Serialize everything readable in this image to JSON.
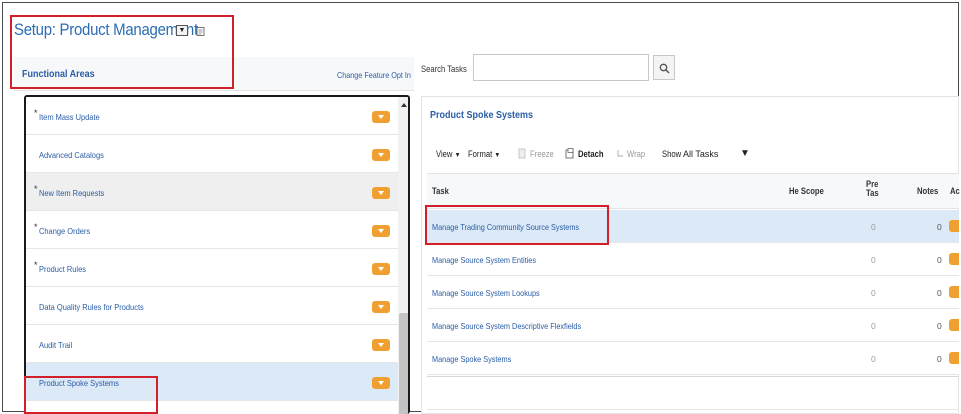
{
  "header": {
    "title": "Setup: Product Management",
    "title_dropdown_icon": "square-dropdown-icon",
    "task_icon": "task-list-icon"
  },
  "functional_areas": {
    "title": "Functional Areas",
    "change_link": "Change Feature Opt In",
    "items": [
      {
        "label": "Item Mass Update",
        "required": true,
        "selected": false
      },
      {
        "label": "Advanced Catalogs",
        "required": false,
        "selected": false
      },
      {
        "label": "New Item Requests",
        "required": true,
        "selected": false
      },
      {
        "label": "Change Orders",
        "required": true,
        "selected": false
      },
      {
        "label": "Product Rules",
        "required": true,
        "selected": false
      },
      {
        "label": "Data Quality Rules for Products",
        "required": false,
        "selected": false
      },
      {
        "label": "Audit Trail",
        "required": false,
        "selected": false
      },
      {
        "label": "Product Spoke Systems",
        "required": false,
        "selected": true
      }
    ]
  },
  "search": {
    "label": "Search Tasks",
    "value": "",
    "placeholder": "",
    "button_icon": "magnifier-icon"
  },
  "tasks_panel": {
    "title": "Product Spoke Systems",
    "toolbar": {
      "view": "View",
      "format": "Format",
      "freeze": "Freeze",
      "detach": "Detach",
      "wrap": "Wrap",
      "show_label": "Show",
      "show_value": "All Tasks",
      "show_options": [
        "All Tasks"
      ]
    },
    "columns": {
      "task": "Task",
      "scope": "He Scope",
      "pre_line1": "Pre",
      "pre_line2": "Tas",
      "notes": "Notes",
      "actions": "Ac"
    },
    "rows": [
      {
        "task": "Manage Trading Community Source Systems",
        "pre": "0",
        "notes": "0",
        "selected": true
      },
      {
        "task": "Manage Source System Entities",
        "pre": "0",
        "notes": "0",
        "selected": false
      },
      {
        "task": "Manage Source System Lookups",
        "pre": "0",
        "notes": "0",
        "selected": false
      },
      {
        "task": "Manage Source System Descriptive Flexfields",
        "pre": "0",
        "notes": "0",
        "selected": false
      },
      {
        "task": "Manage Spoke Systems",
        "pre": "0",
        "notes": "0",
        "selected": false
      }
    ]
  },
  "colors": {
    "link": "#2a5da5",
    "title": "#2a6db5",
    "badge": "#f0a030",
    "highlight": "#d2202a",
    "selection": "#dce9f7"
  }
}
